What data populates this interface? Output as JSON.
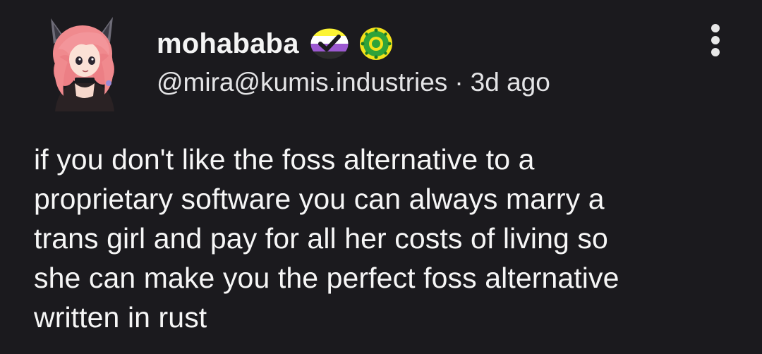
{
  "author": {
    "display_name": "mohababa",
    "handle": "@mira@kumis.industries",
    "separator": "·",
    "timestamp": "3d ago",
    "avatar": "avatar-pink-haired-cat-eared-girl",
    "badges": [
      "nonbinary-flag-check-icon",
      "green-yellow-sun-icon"
    ]
  },
  "menu": {
    "icon": "kebab-menu-icon"
  },
  "post": {
    "lines": [
      "if you don't like the foss alternative to a",
      "proprietary software you can always marry a",
      "trans girl and pay for all her costs of living so",
      "she can make you the perfect foss alternative",
      "written in rust"
    ]
  },
  "colors": {
    "background": "#1b1a1e",
    "text": "#f6f6f6",
    "meta_text": "#e4e4e6"
  }
}
